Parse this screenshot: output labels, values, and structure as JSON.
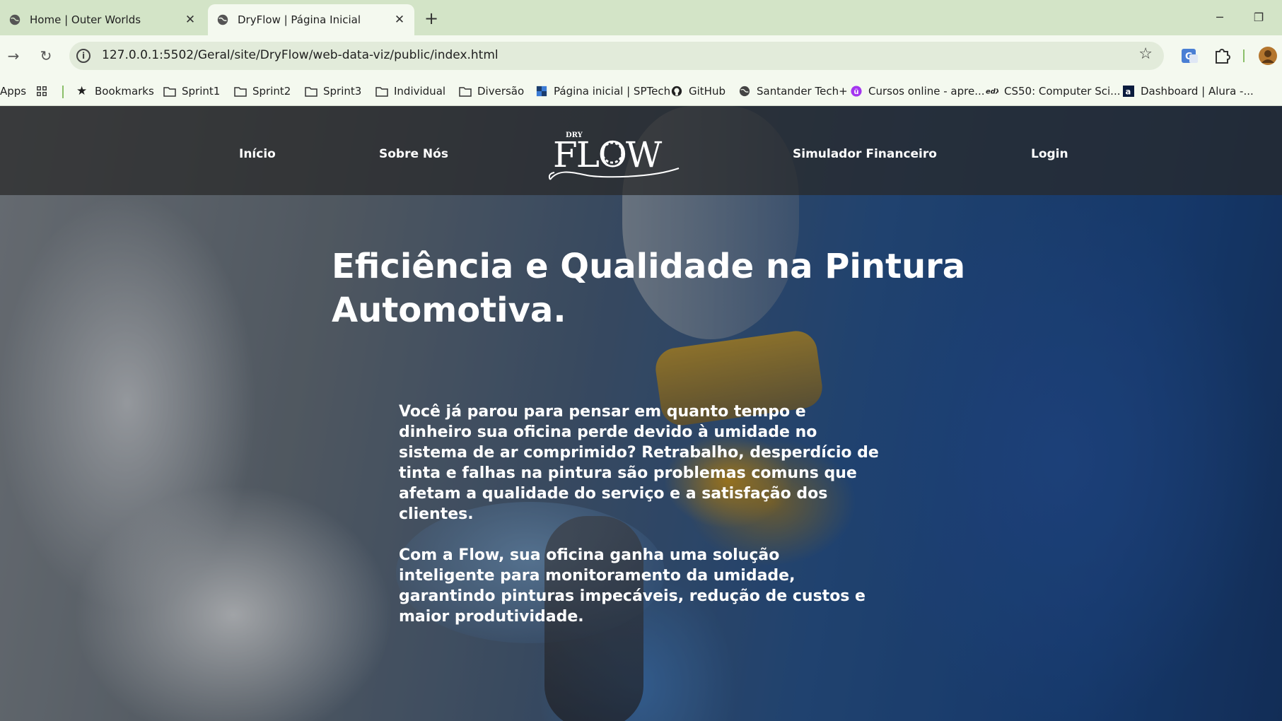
{
  "browser": {
    "tabs": [
      {
        "title": "Home | Outer Worlds",
        "active": false
      },
      {
        "title": "DryFlow | Página Inicial",
        "active": true
      }
    ],
    "new_tab_symbol": "+",
    "close_symbol": "✕",
    "url": "127.0.0.1:5502/Geral/site/DryFlow/web-data-viz/public/index.html",
    "bookmarks": [
      {
        "label": "Apps",
        "icon": "none"
      },
      {
        "label": "",
        "icon": "apps-grid-icon"
      },
      {
        "label": "Bookmarks",
        "icon": "star-icon"
      },
      {
        "label": "Sprint1",
        "icon": "folder-icon"
      },
      {
        "label": "Sprint2",
        "icon": "folder-icon"
      },
      {
        "label": "Sprint3",
        "icon": "folder-icon"
      },
      {
        "label": "Individual",
        "icon": "folder-icon"
      },
      {
        "label": "Diversão",
        "icon": "folder-icon"
      },
      {
        "label": "Página inicial | SPTech",
        "icon": "sptech-icon"
      },
      {
        "label": "GitHub",
        "icon": "github-icon"
      },
      {
        "label": "Santander Tech+",
        "icon": "globe-icon"
      },
      {
        "label": "Cursos online - apre...",
        "icon": "udemy-icon"
      },
      {
        "label": "CS50: Computer Sci...",
        "icon": "edx-icon"
      },
      {
        "label": "Dashboard | Alura -...",
        "icon": "alura-icon"
      }
    ],
    "colors": {
      "tabstrip": "#d3e4c7",
      "toolbar": "#f4f9ef",
      "omnibox": "#e2ebda"
    }
  },
  "site": {
    "nav": {
      "home": "Início",
      "about": "Sobre Nós",
      "simulator": "Simulador Financeiro",
      "login": "Login"
    },
    "logo": {
      "small": "DRY",
      "main": "FLOW"
    },
    "hero": {
      "h_bold1": "Eficiência",
      "h_e": " e ",
      "h_bold2": "Qualidade",
      "h_rest": " na Pintura Automotiva.",
      "paragraph1": "Você já parou para pensar em quanto tempo e dinheiro sua oficina perde devido à umidade no sistema de ar comprimido? Retrabalho, desperdício de tinta e falhas na pintura são problemas comuns que afetam a qualidade do serviço e a satisfação dos clientes.",
      "paragraph2": "Com a Flow, sua oficina ganha uma solução inteligente para monitoramento da umidade, garantindo pinturas impecáveis, redução de custos e maior produtividade."
    }
  }
}
